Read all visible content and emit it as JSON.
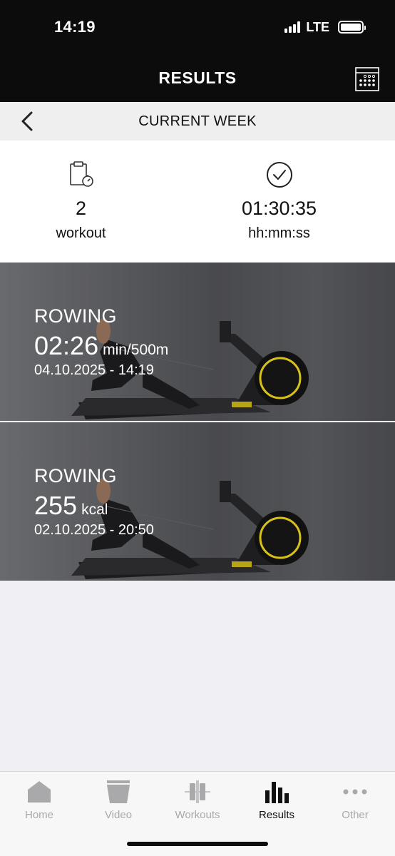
{
  "status_bar": {
    "time": "14:19",
    "network": "LTE",
    "icons": [
      "signal-icon",
      "battery-icon"
    ]
  },
  "header": {
    "title": "RESULTS",
    "calendar_icon": "calendar-icon"
  },
  "week_nav": {
    "title": "CURRENT WEEK",
    "back_icon": "chevron-left-icon"
  },
  "summary": {
    "workouts": {
      "value": "2",
      "unit": "workout",
      "icon": "clipboard-timer-icon"
    },
    "duration": {
      "value": "01:30:35",
      "unit": "hh:mm:ss",
      "icon": "clock-check-icon"
    }
  },
  "workouts": [
    {
      "type": "ROWING",
      "value": "02:26",
      "unit": "min/500m",
      "date": "04.10.2025 - 14:19"
    },
    {
      "type": "ROWING",
      "value": "255",
      "unit": "kcal",
      "date": "02.10.2025 - 20:50"
    }
  ],
  "tabbar": {
    "tabs": [
      {
        "label": "Home",
        "icon": "home-icon",
        "active": false
      },
      {
        "label": "Video",
        "icon": "video-folder-icon",
        "active": false
      },
      {
        "label": "Workouts",
        "icon": "dumbbell-icon",
        "active": false
      },
      {
        "label": "Results",
        "icon": "bar-chart-icon",
        "active": true
      },
      {
        "label": "Other",
        "icon": "more-dots-icon",
        "active": false
      }
    ]
  },
  "colors": {
    "header_bg": "#0c0c0c",
    "accent_yellow": "#d8c21a",
    "tab_inactive": "#a9a9ab",
    "tab_active": "#111111"
  }
}
